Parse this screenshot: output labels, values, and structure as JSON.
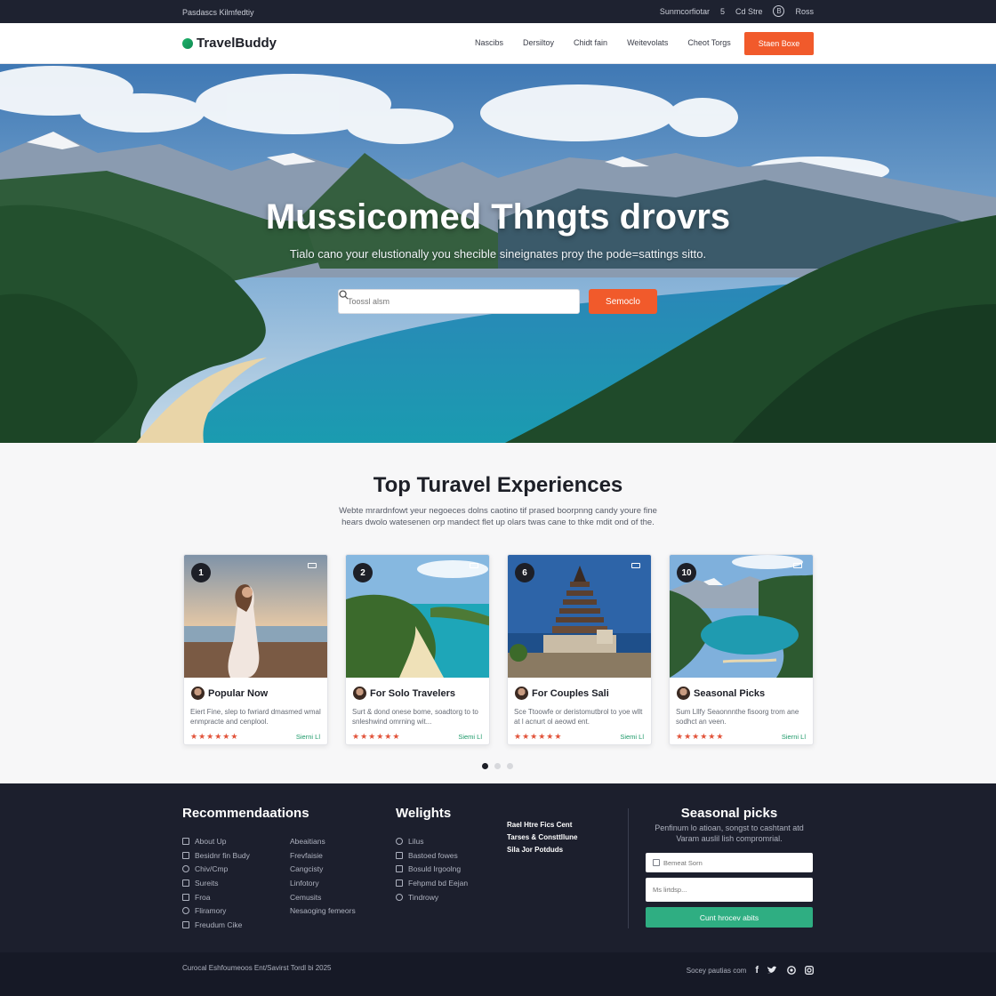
{
  "utility_bar": {
    "left_text": "Pasdascs Kilmfedtiy",
    "right_items": [
      "Sunmcorfiotar",
      "5",
      "Cd Stre",
      "B",
      "Ross"
    ]
  },
  "nav": {
    "brand": "TravelBuddy",
    "links": [
      "Nascibs",
      "Dersiltoy",
      "Chidt fain",
      "Weitevolats",
      "Cheot Torgs"
    ],
    "cta": "Staen Boxe"
  },
  "hero": {
    "title": "Mussicomed Thngts drovrs",
    "subtitle": "Tialo cano your elustionally you shecible sineignates proy the pode=sattings sitto.",
    "search_placeholder": "Toossl alsm",
    "search_button": "Semoclo"
  },
  "experiences": {
    "title": "Top Turavel Experiences",
    "description": "Webte mrardnfowt yeur negoeces dolns caotino tif prased boorpnng candy youre fine hears dwolo watesenen orp mandect flet up olars twas cane to thke mdit ond of the.",
    "cards": [
      {
        "num": "1",
        "title": "Popular Now",
        "desc": "Eiert Fine, slep to fwriard dmasmed wmal enmpracte and cenplool.",
        "stars": "★★★★★★",
        "link": "Sierni Ll"
      },
      {
        "num": "2",
        "title": "For Solo Travelers",
        "desc": "Surt & dond onese bome, soadtorg to to snleshwind omrning wit...",
        "stars": "★★★★★★",
        "link": "Siemi Ll"
      },
      {
        "num": "6",
        "title": "For Couples Sali",
        "desc": "Sce Ttoowfe or deristomutbrol to yoe wllt at l acnurt ol aeowd ent.",
        "stars": "★★★★★★",
        "link": "Siemi Ll"
      },
      {
        "num": "10",
        "title": "Seasonal Picks",
        "desc": "Sum Lllfy Seaonnnthe fisoorg trom ane sodhct an veen.",
        "stars": "★★★★★★",
        "link": "Sierni Ll"
      }
    ],
    "active_dot": 0,
    "dot_count": 3
  },
  "footer": {
    "col1_title": "Recommendaations",
    "col1_left": [
      "About Up",
      "Besidnr fin Budy",
      "Chiv/Cmp",
      "Sureits",
      "Froa",
      "Fliramory",
      "Freudum Cike"
    ],
    "col1_right": [
      "Abeaitians",
      "Frevfaisie",
      "Cangcisty",
      "Linfotory",
      "Cemusits",
      "Nesaoging femeors"
    ],
    "col2_title": "Welights",
    "col2_items": [
      "Lilus",
      "Bastoed fowes",
      "Bosuld Irgoolng",
      "Fehpmd bd Eejan",
      "Tindrowy"
    ],
    "col3_items": [
      "Rael Htre Fics Cent",
      "Tarses & Consttllune",
      "Sila Jor Potduds"
    ],
    "newsletter_title": "Seasonal picks",
    "newsletter_desc": "Penfinum lo atioan, songst to cashtant atd Varam auslil lish compromrial.",
    "email_placeholder": "Bemeat Sorn",
    "message_placeholder": "Ms lirtdsp...",
    "button": "Cunt hrocev abits"
  },
  "bottom": {
    "copyright": "Curocal Eshfoumeoos Ent/Savirst Tordl bi 2025",
    "social_label": "Socey pautias com"
  },
  "colors": {
    "accent": "#f15a2b",
    "dark": "#1c1f2d",
    "green": "#2fae82"
  }
}
